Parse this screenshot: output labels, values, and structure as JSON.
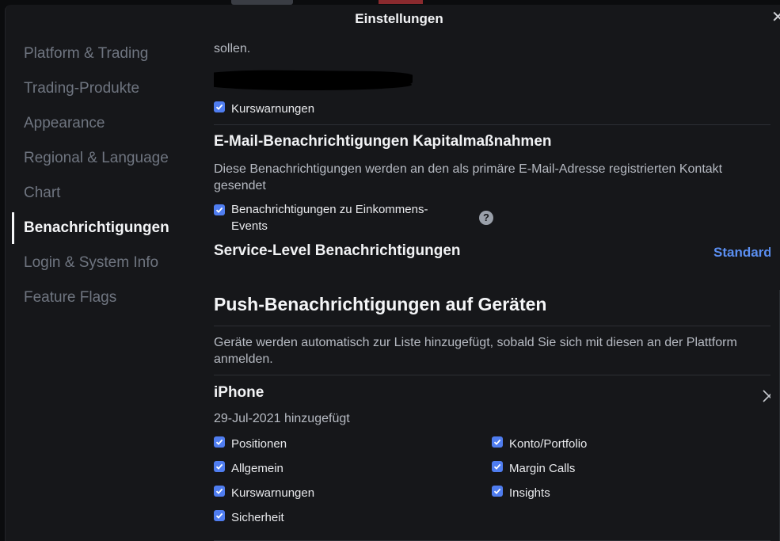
{
  "dialog": {
    "title": "Einstellungen",
    "close_icon": "close-icon"
  },
  "sidebar": {
    "items": [
      {
        "label": "Platform & Trading",
        "active": false
      },
      {
        "label": "Trading-Produkte",
        "active": false
      },
      {
        "label": "Appearance",
        "active": false
      },
      {
        "label": "Regional & Language",
        "active": false
      },
      {
        "label": "Chart",
        "active": false
      },
      {
        "label": "Benachrichtigungen",
        "active": true
      },
      {
        "label": "Login & System Info",
        "active": false
      },
      {
        "label": "Feature Flags",
        "active": false
      }
    ]
  },
  "content": {
    "cut_text": "sollen.",
    "kurswarnungen_top": {
      "label": "Kurswarnungen",
      "checked": true
    },
    "email_section": {
      "title": "E-Mail-Benachrichtigungen Kapitalmaßnahmen",
      "description": "Diese Benachrichtigungen werden an den als primäre E-Mail-Adresse registrierten Kontakt gesendet",
      "checkbox": {
        "label": "Benachrichtigungen zu Einkommens-Events",
        "checked": true
      },
      "help_icon": "?"
    },
    "service_level": {
      "title": "Service-Level Benachrichtigungen",
      "link": "Standard"
    },
    "push_section": {
      "title": "Push-Benachrichtigungen auf Geräten",
      "description": "Geräte werden automatisch zur Liste hinzugefügt, sobald Sie sich mit diesen an der Plattform anmelden."
    },
    "device": {
      "name": "iPhone",
      "added": "29-Jul-2021 hinzugefügt",
      "options_left": [
        {
          "label": "Positionen",
          "checked": true
        },
        {
          "label": "Allgemein",
          "checked": true
        },
        {
          "label": "Kurswarnungen",
          "checked": true
        },
        {
          "label": "Sicherheit",
          "checked": true
        }
      ],
      "options_right": [
        {
          "label": "Konto/Portfolio",
          "checked": true
        },
        {
          "label": "Margin Calls",
          "checked": true
        },
        {
          "label": "Insights",
          "checked": true
        }
      ]
    }
  },
  "colors": {
    "accent": "#4f7df0",
    "link": "#5b8ff2",
    "background": "#16171a"
  }
}
